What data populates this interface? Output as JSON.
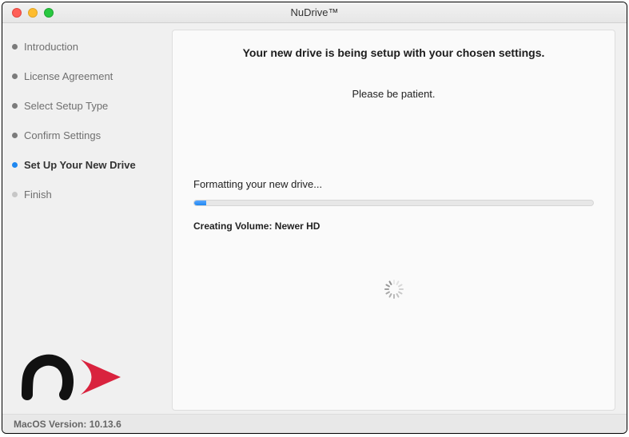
{
  "window": {
    "title": "NuDrive™"
  },
  "steps": [
    {
      "label": "Introduction",
      "state": "done"
    },
    {
      "label": "License Agreement",
      "state": "done"
    },
    {
      "label": "Select Setup Type",
      "state": "done"
    },
    {
      "label": "Confirm Settings",
      "state": "done"
    },
    {
      "label": "Set Up Your New Drive",
      "state": "active"
    },
    {
      "label": "Finish",
      "state": "pending"
    }
  ],
  "content": {
    "headline": "Your new drive is being setup with your chosen settings.",
    "subtext": "Please be patient.",
    "task": "Formatting your new drive...",
    "progress_pct": 3,
    "detail": "Creating Volume: Newer HD"
  },
  "footer": {
    "os_label": "MacOS Version: 10.13.6"
  },
  "colors": {
    "accent_blue": "#1e87f0",
    "logo_red": "#d9233e",
    "logo_black": "#111111"
  }
}
